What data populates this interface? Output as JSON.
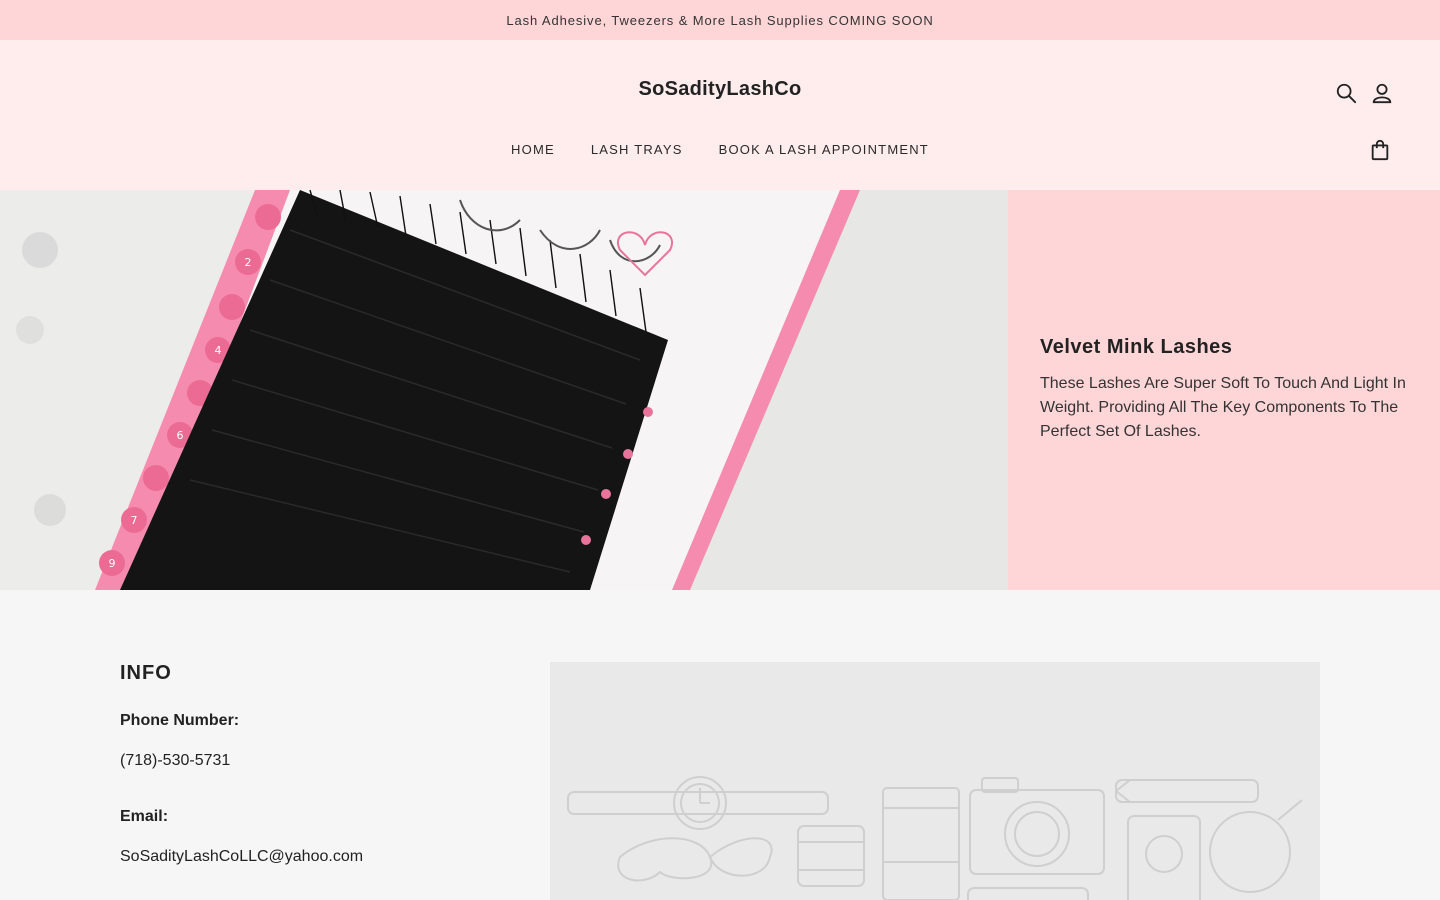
{
  "announcement": "Lash Adhesive, Tweezers & More Lash Supplies COMING SOON",
  "header": {
    "logo": "SoSadityLashCo",
    "nav": [
      "HOME",
      "LASH TRAYS",
      "BOOK A LASH APPOINTMENT"
    ],
    "icons": [
      "search-icon",
      "account-icon",
      "cart-icon"
    ]
  },
  "hero": {
    "title": "Velvet Mink Lashes",
    "text": "These Lashes Are Super Soft To Touch And Light In Weight. Providing All The Key Components To The Perfect Set Of Lashes."
  },
  "footer": {
    "heading": "INFO",
    "phone_label": "Phone Number:",
    "phone": "(718)-530-5731",
    "email_label": "Email:",
    "email": "SoSadityLashCoLLC@yahoo.com"
  },
  "colors": {
    "announcement_bg": "#ffd6d8",
    "header_bg": "#ffeced",
    "hero_panel_bg": "#ffd6d8",
    "footer_bg": "#f6f6f6",
    "accent_pink": "#f58cb0"
  }
}
